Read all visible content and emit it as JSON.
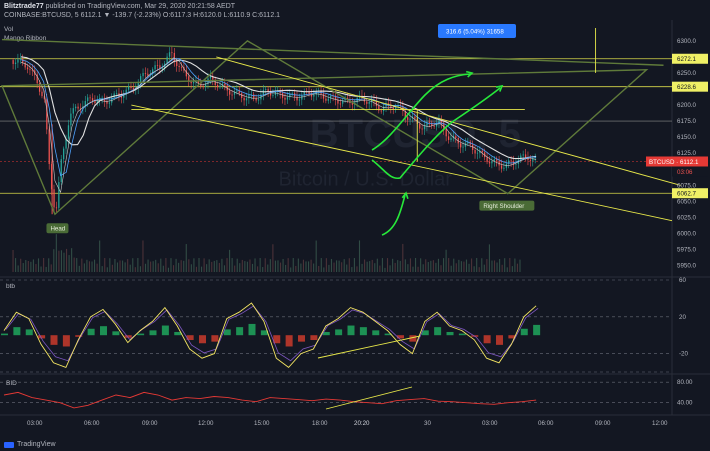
{
  "header": {
    "publisher": "Blitztrade77",
    "published_text": "published on TradingView.com, Mar 29, 2020 20:21:58 AEDT",
    "symbol_line": "COINBASE:BTCUSD, 5  6112.1  ▼ -139.7 (-2.23%)  O:6117.3  H:6120.0  L:6110.9  C:6112.1"
  },
  "indicators_top": [
    "Vol",
    "Mango Ribbon"
  ],
  "watermark": {
    "symbol": "BTCUSD, 5",
    "name": "Bitcoin / U.S. Dollar"
  },
  "measure_box": "316.6 (5.04%) 31658",
  "annotations": {
    "head": "Head",
    "right_shoulder": "Right Shoulder"
  },
  "price_tags": {
    "current": "BTCUSD · 6112.1",
    "countdown": "03:06",
    "level_upper": "6272.1",
    "level_mid": "6228.6",
    "level_lower": "6062.7"
  },
  "colors": {
    "background": "#131722",
    "up": "#26a69a",
    "down": "#ef5350",
    "annotation_line": "#e8e84a",
    "arrow": "#27e83a",
    "hs_outline": "#5f7a3a",
    "level_tag": "#f0f066",
    "current_tag": "#e53935",
    "measure_tag": "#2979ff"
  },
  "panels": {
    "btb": {
      "label": "btb",
      "scale": [
        "60",
        "20",
        "-20"
      ]
    },
    "bid": {
      "label": "BID",
      "scale": [
        "80.00",
        "40.00"
      ]
    }
  },
  "branding": "TradingView",
  "chart_data": [
    {
      "type": "candlestick",
      "title": "COINBASE:BTCUSD, 5",
      "y_ticks": [
        "6300.0",
        "6250.0",
        "6200.0",
        "6175.0",
        "6150.0",
        "6125.0",
        "6100.0",
        "6075.0",
        "6050.0",
        "6025.0",
        "6000.0",
        "5975.0",
        "5950.0"
      ],
      "x_ticks": [
        "03:00",
        "06:00",
        "09:00",
        "12:00",
        "15:00",
        "18:00",
        "20:20",
        "30",
        "03:00",
        "06:00",
        "09:00",
        "12:00"
      ],
      "x_range_hours": [
        1.5,
        25.1
      ],
      "ylim": [
        5940,
        6320
      ],
      "horizontal_levels": [
        6272.1,
        6228.6,
        6062.7
      ],
      "close_path": [
        [
          1.8,
          6270
        ],
        [
          2.3,
          6262
        ],
        [
          2.6,
          6240
        ],
        [
          2.9,
          6210
        ],
        [
          3.1,
          6090
        ],
        [
          3.3,
          6030
        ],
        [
          3.5,
          6110
        ],
        [
          3.8,
          6185
        ],
        [
          4.2,
          6200
        ],
        [
          4.6,
          6210
        ],
        [
          5.0,
          6205
        ],
        [
          5.5,
          6215
        ],
        [
          6.0,
          6225
        ],
        [
          6.5,
          6250
        ],
        [
          7.0,
          6260
        ],
        [
          7.4,
          6280
        ],
        [
          7.8,
          6250
        ],
        [
          8.3,
          6230
        ],
        [
          8.8,
          6240
        ],
        [
          9.3,
          6225
        ],
        [
          9.8,
          6215
        ],
        [
          10.3,
          6210
        ],
        [
          10.8,
          6222
        ],
        [
          11.3,
          6215
        ],
        [
          11.8,
          6212
        ],
        [
          12.4,
          6220
        ],
        [
          13.0,
          6210
        ],
        [
          13.6,
          6205
        ],
        [
          14.2,
          6210
        ],
        [
          14.8,
          6195
        ],
        [
          15.3,
          6200
        ],
        [
          15.8,
          6180
        ],
        [
          16.3,
          6165
        ],
        [
          16.8,
          6175
        ],
        [
          17.2,
          6150
        ],
        [
          17.6,
          6140
        ],
        [
          18.0,
          6135
        ],
        [
          18.4,
          6120
        ],
        [
          18.8,
          6110
        ],
        [
          19.2,
          6105
        ],
        [
          19.6,
          6115
        ],
        [
          20.0,
          6120
        ],
        [
          20.3,
          6112.1
        ]
      ]
    },
    {
      "type": "line",
      "title": "btb",
      "ylim": [
        -40,
        60
      ],
      "series": [
        {
          "values": [
            5,
            25,
            18,
            -10,
            -30,
            -35,
            -5,
            20,
            28,
            12,
            -8,
            5,
            15,
            30,
            10,
            -15,
            -25,
            -20,
            18,
            25,
            35,
            15,
            -25,
            -35,
            -20,
            -15,
            10,
            18,
            30,
            25,
            15,
            5,
            -10,
            -20,
            15,
            25,
            10,
            5,
            -5,
            -25,
            -30,
            -10,
            20,
            32
          ]
        }
      ]
    },
    {
      "type": "line",
      "title": "BID",
      "ylim": [
        20,
        90
      ],
      "series": [
        {
          "values": [
            55,
            60,
            50,
            45,
            40,
            30,
            35,
            45,
            55,
            50,
            60,
            55,
            45,
            50,
            48,
            52,
            50,
            45,
            42,
            50,
            48,
            46,
            44,
            47,
            45,
            42,
            40,
            38,
            44,
            46,
            48,
            43,
            42,
            40,
            38,
            37,
            40,
            42,
            45
          ]
        }
      ]
    }
  ]
}
